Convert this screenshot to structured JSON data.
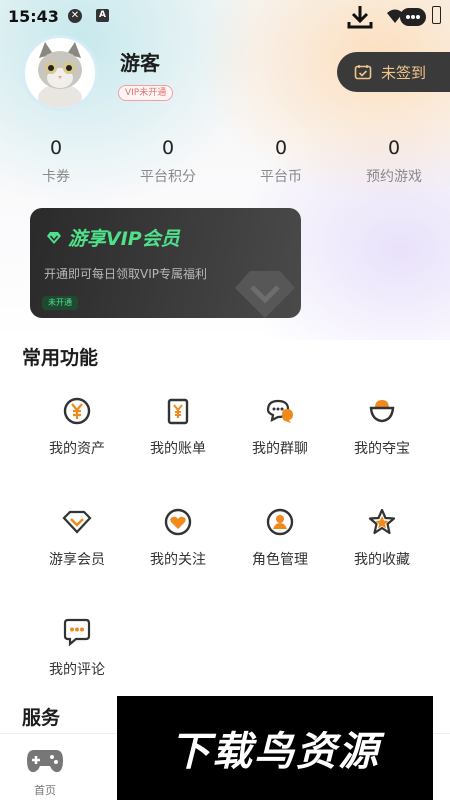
{
  "status_bar": {
    "time": "15:43",
    "a_label": "A"
  },
  "profile": {
    "username": "游客",
    "vip_status": "VIP未开通",
    "checkin_label": "未签到"
  },
  "stats": [
    {
      "value": "0",
      "label": "卡券"
    },
    {
      "value": "0",
      "label": "平台积分"
    },
    {
      "value": "0",
      "label": "平台币"
    },
    {
      "value": "0",
      "label": "预约游戏"
    }
  ],
  "vip_card": {
    "title": "游享VIP会员",
    "description": "开通即可每日领取VIP专属福利",
    "tag": "未开通"
  },
  "functions": {
    "title": "常用功能",
    "items": [
      {
        "label": "我的资产",
        "icon": "yen-coin-icon"
      },
      {
        "label": "我的账单",
        "icon": "bill-icon"
      },
      {
        "label": "我的群聊",
        "icon": "group-chat-icon"
      },
      {
        "label": "我的夺宝",
        "icon": "treasure-icon"
      },
      {
        "label": "游享会员",
        "icon": "vip-diamond-icon"
      },
      {
        "label": "我的关注",
        "icon": "heart-icon"
      },
      {
        "label": "角色管理",
        "icon": "user-role-icon"
      },
      {
        "label": "我的收藏",
        "icon": "star-icon"
      },
      {
        "label": "我的评论",
        "icon": "comment-icon"
      }
    ]
  },
  "next_section": {
    "title": "服务"
  },
  "bottom_nav": {
    "home_label": "首页"
  },
  "watermark": {
    "text": "下载鸟资源"
  },
  "colors": {
    "accent": "#f08a1c",
    "vip_green": "#4fe08a",
    "dark": "#3a3a3a",
    "checkin_text": "#f2c48a"
  }
}
